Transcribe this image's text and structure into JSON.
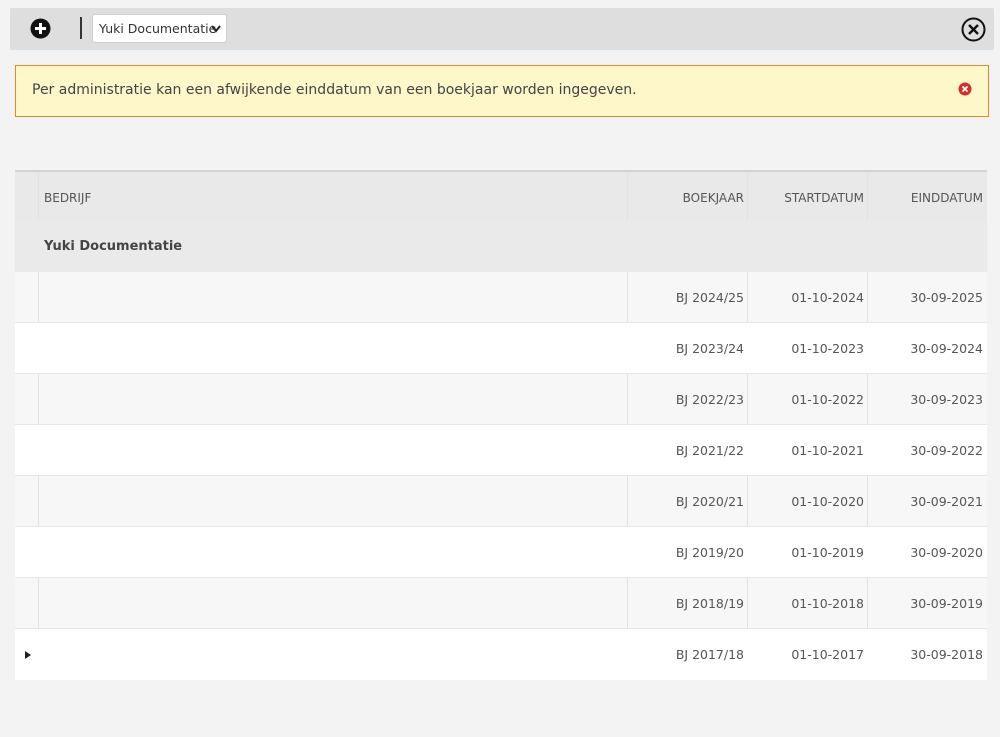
{
  "toolbar": {
    "add_icon": "plus-circle-icon",
    "administration_select": {
      "selected": "Yuki Documentatie"
    },
    "close_icon": "close-circle-icon"
  },
  "alert": {
    "message": "Per administratie kan een afwijkende einddatum van een boekjaar worden ingegeven.",
    "close_icon": "error-close-icon",
    "accent_color": "#e8872e",
    "background_color": "#fdf7c9"
  },
  "table": {
    "columns": {
      "company": "BEDRIJF",
      "fiscal_year": "BOEKJAAR",
      "start_date": "STARTDATUM",
      "end_date": "EINDDATUM"
    },
    "group": {
      "company": "Yuki Documentatie"
    },
    "rows": [
      {
        "fiscal_year": "BJ 2024/25",
        "start_date": "01-10-2024",
        "end_date": "30-09-2025"
      },
      {
        "fiscal_year": "BJ 2023/24",
        "start_date": "01-10-2023",
        "end_date": "30-09-2024"
      },
      {
        "fiscal_year": "BJ 2022/23",
        "start_date": "01-10-2022",
        "end_date": "30-09-2023"
      },
      {
        "fiscal_year": "BJ 2021/22",
        "start_date": "01-10-2021",
        "end_date": "30-09-2022"
      },
      {
        "fiscal_year": "BJ 2020/21",
        "start_date": "01-10-2020",
        "end_date": "30-09-2021"
      },
      {
        "fiscal_year": "BJ 2019/20",
        "start_date": "01-10-2019",
        "end_date": "30-09-2020"
      },
      {
        "fiscal_year": "BJ 2018/19",
        "start_date": "01-10-2018",
        "end_date": "30-09-2019"
      },
      {
        "fiscal_year": "BJ 2017/18",
        "start_date": "01-10-2017",
        "end_date": "30-09-2018"
      }
    ]
  }
}
